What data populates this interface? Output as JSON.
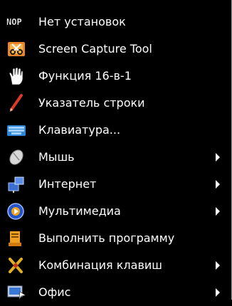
{
  "menu": {
    "items": [
      {
        "label": "Нет установок",
        "icon": "nop-icon",
        "submenu": false
      },
      {
        "label": "Screen Capture Tool",
        "icon": "scissors-icon",
        "submenu": false
      },
      {
        "label": "Функция 16-в-1",
        "icon": "hand-icon",
        "submenu": false
      },
      {
        "label": "Указатель строки",
        "icon": "pen-icon",
        "submenu": false
      },
      {
        "label": "Клавиатура...",
        "icon": "keyboard-icon",
        "submenu": false
      },
      {
        "label": "Мышь",
        "icon": "mouse-icon",
        "submenu": true
      },
      {
        "label": "Интернет",
        "icon": "network-icon",
        "submenu": true
      },
      {
        "label": "Мультимедиа",
        "icon": "media-icon",
        "submenu": true
      },
      {
        "label": "Выполнить программу",
        "icon": "run-program-icon",
        "submenu": false
      },
      {
        "label": "Комбинация клавиш",
        "icon": "hotkey-icon",
        "submenu": true
      },
      {
        "label": "Офис",
        "icon": "office-icon",
        "submenu": true
      }
    ]
  }
}
